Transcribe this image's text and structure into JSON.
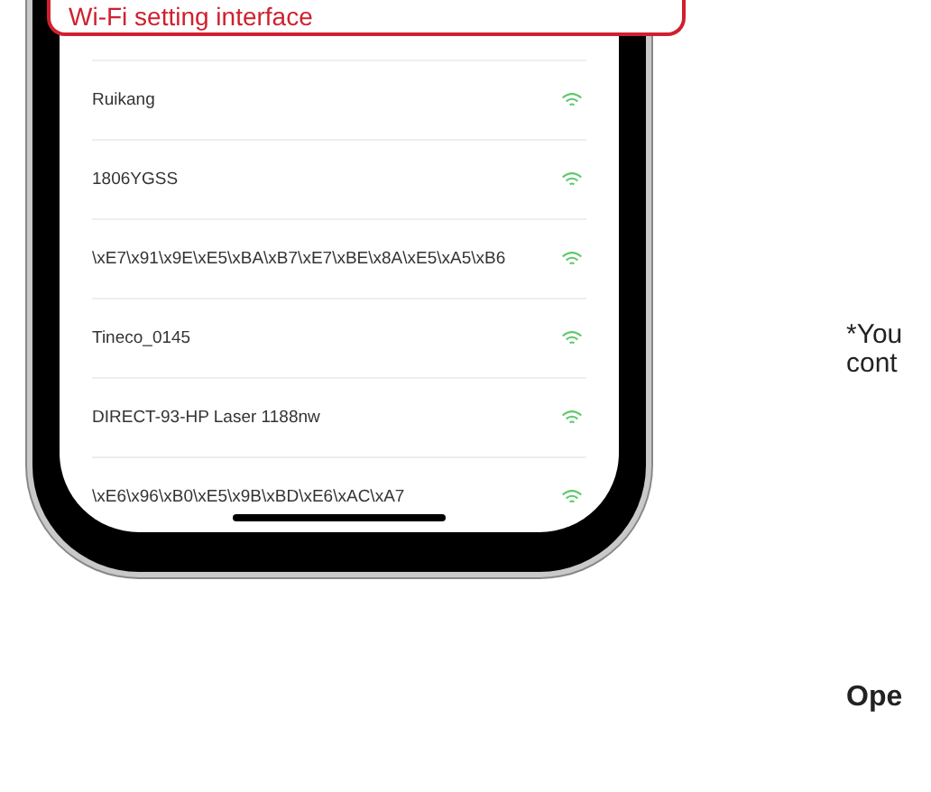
{
  "callout": {
    "title": "Wi-Fi setting interface"
  },
  "networks": [
    {
      "name": "Ruikang"
    },
    {
      "name": "1806YGSS"
    },
    {
      "name": "\\xE7\\x91\\x9E\\xE5\\xBA\\xB7\\xE7\\xBE\\x8A\\xE5\\xA5\\xB6"
    },
    {
      "name": "Tineco_0145"
    },
    {
      "name": "DIRECT-93-HP Laser 1188nw"
    },
    {
      "name": "\\xE6\\x96\\xB0\\xE5\\x9B\\xBD\\xE6\\xAC\\xA7"
    }
  ],
  "note": {
    "lines": [
      "*You",
      "cont"
    ]
  },
  "heading": "Ope"
}
